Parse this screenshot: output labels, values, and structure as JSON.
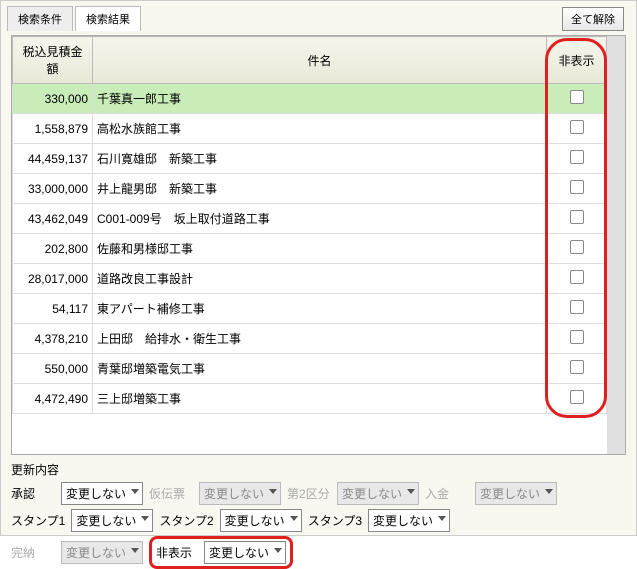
{
  "tabs": {
    "search_cond": "検索条件",
    "search_result": "検索結果"
  },
  "btn_clear_all": "全て解除",
  "columns": {
    "amount": "税込見積金額",
    "name": "件名",
    "hide": "非表示"
  },
  "rows": [
    {
      "amount": "330,000",
      "name": "千葉真一郎工事",
      "selected": true
    },
    {
      "amount": "1,558,879",
      "name": "高松水族館工事"
    },
    {
      "amount": "44,459,137",
      "name": "石川寛雄邸　新築工事"
    },
    {
      "amount": "33,000,000",
      "name": "井上龍男邸　新築工事"
    },
    {
      "amount": "43,462,049",
      "name": "C001-009号　坂上取付道路工事"
    },
    {
      "amount": "202,800",
      "name": "佐藤和男様邸工事"
    },
    {
      "amount": "28,017,000",
      "name": "道路改良工事設計"
    },
    {
      "amount": "54,117",
      "name": "東アパート補修工事"
    },
    {
      "amount": "4,378,210",
      "name": "上田邸　給排水・衛生工事"
    },
    {
      "amount": "550,000",
      "name": "青葉邸増築電気工事"
    },
    {
      "amount": "4,472,490",
      "name": "三上邸増築工事"
    }
  ],
  "form": {
    "title": "更新内容",
    "approval": "承認",
    "approval_val": "変更しない",
    "provisional": "仮伝票",
    "provisional_val": "変更しない",
    "section2": "第2区分",
    "section2_val": "変更しない",
    "deposit": "入金",
    "deposit_val": "変更しない",
    "stamp1": "スタンプ1",
    "stamp1_val": "変更しない",
    "stamp2": "スタンプ2",
    "stamp2_val": "変更しない",
    "stamp3": "スタンプ3",
    "stamp3_val": "変更しない",
    "complete": "完納",
    "complete_val": "変更しない",
    "hide": "非表示",
    "hide_val": "変更しない"
  }
}
